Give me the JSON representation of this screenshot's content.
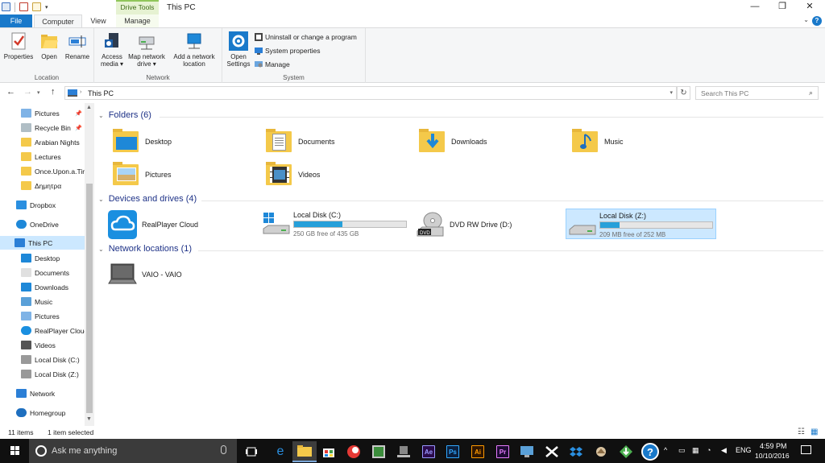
{
  "title_bar": {
    "context_tab_header": "Drive Tools",
    "window_title": "This PC",
    "minimize": "—",
    "maximize": "❐",
    "close": "✕"
  },
  "ribbon_tabs": {
    "file": "File",
    "computer": "Computer",
    "view": "View",
    "manage": "Manage",
    "help": "?"
  },
  "ribbon": {
    "location": {
      "label": "Location",
      "properties": "Properties",
      "open": "Open",
      "rename": "Rename"
    },
    "network": {
      "label": "Network",
      "access_media_1": "Access",
      "access_media_2": "media ▾",
      "map_drive_1": "Map network",
      "map_drive_2": "drive ▾",
      "add_location_1": "Add a network",
      "add_location_2": "location"
    },
    "system": {
      "label": "System",
      "open_settings_1": "Open",
      "open_settings_2": "Settings",
      "uninstall": "Uninstall or change a program",
      "system_properties": "System properties",
      "manage": "Manage"
    }
  },
  "address_bar": {
    "path": "This PC",
    "search_placeholder": "Search This PC"
  },
  "sidebar": {
    "items": [
      {
        "label": "Pictures",
        "icon": "pictures-icon",
        "pinned": true
      },
      {
        "label": "Recycle Bin",
        "icon": "recycle-bin-icon",
        "pinned": true
      },
      {
        "label": "Arabian Nights",
        "icon": "folder-icon"
      },
      {
        "label": "Lectures",
        "icon": "folder-icon"
      },
      {
        "label": "Once.Upon.a.Tir",
        "icon": "folder-icon"
      },
      {
        "label": "Δημητρα",
        "icon": "folder-icon"
      },
      {
        "label": "Dropbox",
        "icon": "dropbox-icon"
      },
      {
        "label": "OneDrive",
        "icon": "onedrive-icon"
      },
      {
        "label": "This PC",
        "icon": "pc-icon",
        "selected": true
      },
      {
        "label": "Desktop",
        "icon": "desktop-icon"
      },
      {
        "label": "Documents",
        "icon": "documents-icon"
      },
      {
        "label": "Downloads",
        "icon": "downloads-icon"
      },
      {
        "label": "Music",
        "icon": "music-icon"
      },
      {
        "label": "Pictures",
        "icon": "pictures-icon"
      },
      {
        "label": "RealPlayer Clouc",
        "icon": "realplayer-icon"
      },
      {
        "label": "Videos",
        "icon": "videos-icon"
      },
      {
        "label": "Local Disk (C:)",
        "icon": "disk-icon"
      },
      {
        "label": "Local Disk (Z:)",
        "icon": "disk-icon"
      },
      {
        "label": "Network",
        "icon": "network-icon"
      },
      {
        "label": "Homegroup",
        "icon": "homegroup-icon"
      }
    ]
  },
  "main": {
    "folders_header": "Folders (6)",
    "folders": [
      "Desktop",
      "Documents",
      "Downloads",
      "Music",
      "Pictures",
      "Videos"
    ],
    "drives_header": "Devices and drives (4)",
    "drives": [
      {
        "name": "RealPlayer Cloud"
      },
      {
        "name": "Local Disk (C:)",
        "free": "250 GB free of 435 GB",
        "used_fraction": 0.43
      },
      {
        "name": "DVD RW Drive (D:)"
      },
      {
        "name": "Local Disk (Z:)",
        "free": "209 MB free of 252 MB",
        "used_fraction": 0.17
      }
    ],
    "network_header": "Network locations (1)",
    "network_locations": [
      "VAIO - VAIO"
    ]
  },
  "status_bar": {
    "items": "11 items",
    "selected": "1 item selected"
  },
  "taskbar": {
    "search_text": "Ask me anything",
    "language": "ENG",
    "time": "4:59 PM",
    "date": "10/10/2016",
    "apps": [
      {
        "name": "Ae",
        "color": "#2a0a4a",
        "fg": "#9999ff"
      },
      {
        "name": "Ps",
        "color": "#0a1f3d",
        "fg": "#31a8ff"
      },
      {
        "name": "Ai",
        "color": "#2e1500",
        "fg": "#ff9a00"
      },
      {
        "name": "Pr",
        "color": "#1d0a33",
        "fg": "#e77cff"
      }
    ]
  },
  "colors": {
    "accent": "#1979ca",
    "selection": "#cce8ff",
    "drive_fill": "#26a0da",
    "section_header": "#1e3287"
  }
}
